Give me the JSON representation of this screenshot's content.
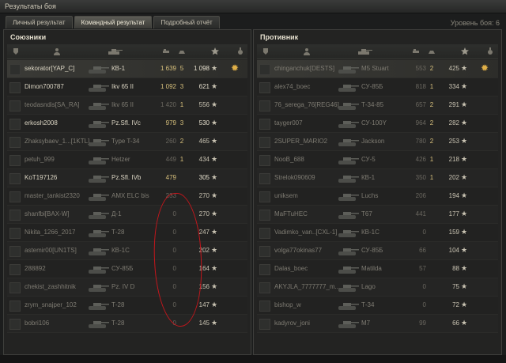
{
  "window": {
    "title": "Результаты боя"
  },
  "tabs": [
    {
      "label": "Личный результат",
      "active": false
    },
    {
      "label": "Командный результат",
      "active": true
    },
    {
      "label": "Подробный отчёт",
      "active": false
    }
  ],
  "battle_level": "Уровень боя: 6",
  "allies": {
    "title": "Союзники",
    "rows": [
      {
        "player": "sekorator[YAP_C]",
        "tank": "КВ-1",
        "damage": "1 639",
        "kills": "5",
        "xp": "1 098",
        "alive": true,
        "medal": true
      },
      {
        "player": "Dimon700787",
        "tank": "Ikv 65 II",
        "damage": "1 092",
        "kills": "3",
        "xp": "621",
        "alive": true
      },
      {
        "player": "teodasndis[SA_RA]",
        "tank": "Ikv 65 II",
        "damage": "1 420",
        "kills": "1",
        "xp": "556",
        "alive": false
      },
      {
        "player": "erkosh2008",
        "tank": "Pz.Sfl. IVc",
        "damage": "979",
        "kills": "3",
        "xp": "530",
        "alive": true
      },
      {
        "player": "Zhaksybaev_1...[1KTL]",
        "tank": "Type T-34",
        "damage": "260",
        "kills": "2",
        "xp": "465",
        "alive": false
      },
      {
        "player": "petuh_999",
        "tank": "Hetzer",
        "damage": "449",
        "kills": "1",
        "xp": "434",
        "alive": false
      },
      {
        "player": "KoT197126",
        "tank": "Pz.Sfl. IVb",
        "damage": "479",
        "kills": "",
        "xp": "305",
        "alive": true
      },
      {
        "player": "master_tankist2320",
        "tank": "AMX ELC bis",
        "damage": "233",
        "kills": "",
        "xp": "270",
        "alive": false
      },
      {
        "player": "shanfbi[BAX-W]",
        "tank": "Д-1",
        "damage": "0",
        "kills": "",
        "xp": "270",
        "alive": false
      },
      {
        "player": "Nikita_1266_2017",
        "tank": "Т-28",
        "damage": "0",
        "kills": "",
        "xp": "247",
        "alive": false
      },
      {
        "player": "astemir00[UN1TS]",
        "tank": "КВ-1С",
        "damage": "0",
        "kills": "",
        "xp": "202",
        "alive": false
      },
      {
        "player": "288892",
        "tank": "СУ-85Б",
        "damage": "0",
        "kills": "",
        "xp": "164",
        "alive": false
      },
      {
        "player": "chekist_zashhitnik",
        "tank": "Pz. IV D",
        "damage": "0",
        "kills": "",
        "xp": "156",
        "alive": false
      },
      {
        "player": "zrym_snajper_102",
        "tank": "Т-28",
        "damage": "0",
        "kills": "",
        "xp": "147",
        "alive": false
      },
      {
        "player": "bobri106",
        "tank": "Т-28",
        "damage": "0",
        "kills": "",
        "xp": "145",
        "alive": false
      }
    ]
  },
  "enemies": {
    "title": "Противник",
    "rows": [
      {
        "player": "chinganchuk[DESTS]",
        "tank": "M5 Stuart",
        "damage": "553",
        "kills": "2",
        "xp": "425",
        "alive": false,
        "medal": true
      },
      {
        "player": "alex74_boec",
        "tank": "СУ-85Б",
        "damage": "818",
        "kills": "1",
        "xp": "334",
        "alive": false
      },
      {
        "player": "76_serega_76[REG46]",
        "tank": "Т-34-85",
        "damage": "657",
        "kills": "2",
        "xp": "291",
        "alive": false
      },
      {
        "player": "tayger007",
        "tank": "СУ-100Y",
        "damage": "964",
        "kills": "2",
        "xp": "282",
        "alive": false
      },
      {
        "player": "2SUPER_MARIO2",
        "tank": "Jackson",
        "damage": "780",
        "kills": "2",
        "xp": "253",
        "alive": false
      },
      {
        "player": "NooB_688",
        "tank": "СУ-5",
        "damage": "426",
        "kills": "1",
        "xp": "218",
        "alive": false
      },
      {
        "player": "Strelok090609",
        "tank": "КВ-1",
        "damage": "350",
        "kills": "1",
        "xp": "202",
        "alive": false
      },
      {
        "player": "uniksem",
        "tank": "Luchs",
        "damage": "206",
        "kills": "",
        "xp": "194",
        "alive": false
      },
      {
        "player": "MaFTuHEC",
        "tank": "T67",
        "damage": "441",
        "kills": "",
        "xp": "177",
        "alive": false
      },
      {
        "player": "Vadimko_van..[CXL-1]",
        "tank": "КВ-1С",
        "damage": "0",
        "kills": "",
        "xp": "159",
        "alive": false
      },
      {
        "player": "volga77okinas77",
        "tank": "СУ-85Б",
        "damage": "66",
        "kills": "",
        "xp": "104",
        "alive": false
      },
      {
        "player": "Dalas_boec",
        "tank": "Matilda",
        "damage": "57",
        "kills": "",
        "xp": "88",
        "alive": false
      },
      {
        "player": "AKYJLA_7777777_m...",
        "tank": "Lago",
        "damage": "0",
        "kills": "",
        "xp": "75",
        "alive": false
      },
      {
        "player": "bishop_w",
        "tank": "Т-34",
        "damage": "0",
        "kills": "",
        "xp": "72",
        "alive": false
      },
      {
        "player": "kadyrov_joni",
        "tank": "M7",
        "damage": "99",
        "kills": "",
        "xp": "66",
        "alive": false
      }
    ]
  },
  "colors": {
    "annotation_ring": "#c4161c",
    "medal": "#e0b048"
  },
  "icons": [
    "platoon-icon",
    "player-icon",
    "tank-icon",
    "damage-icon",
    "kills-icon",
    "xp-star-icon",
    "medal-icon"
  ]
}
